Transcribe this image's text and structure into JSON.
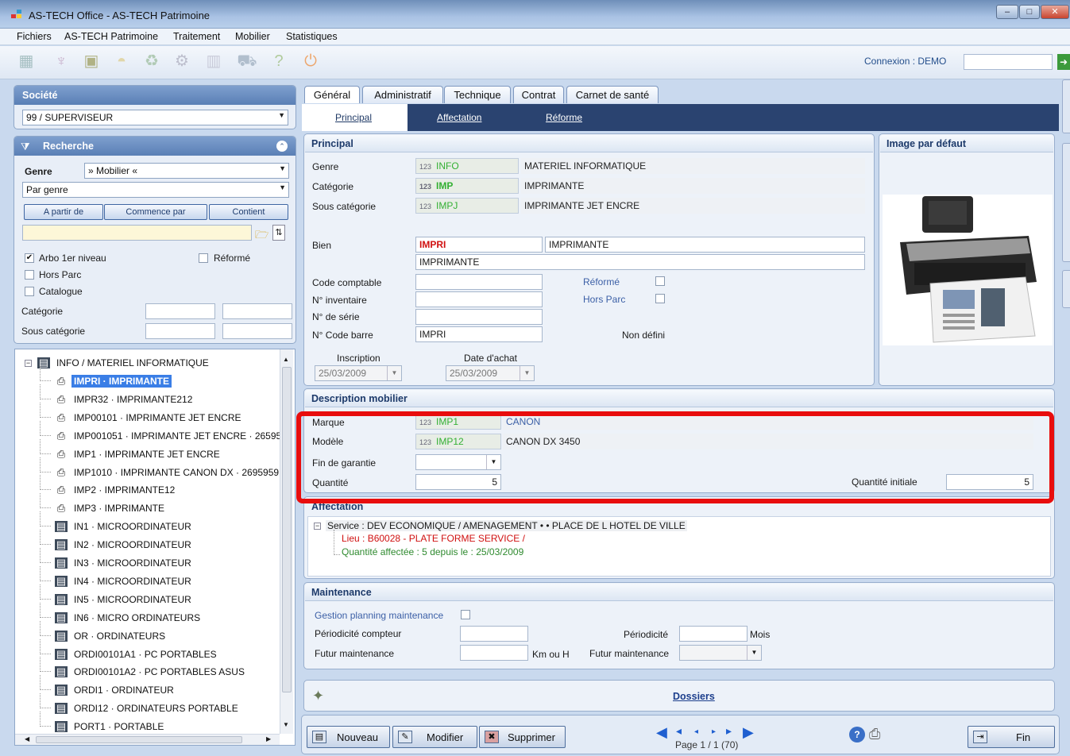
{
  "window": {
    "title": "AS-TECH Office - AS-TECH Patrimoine",
    "minimize": "–",
    "maximize": "□",
    "close": "✕"
  },
  "menu": [
    "Fichiers",
    "AS-TECH Patrimoine",
    "Traitement",
    "Mobilier",
    "Statistiques"
  ],
  "toolbar": {
    "icons": [
      "building-icon",
      "pin-icon",
      "chest-icon",
      "hardhat-icon",
      "recycle-icon",
      "gears-icon",
      "books-icon",
      "truck-icon",
      "help-icon",
      "power-icon"
    ],
    "connexion": "Connexion : DEMO"
  },
  "sidebar": {
    "societe_title": "Société",
    "societe_value": "99 / SUPERVISEUR",
    "recherche_title": "Recherche",
    "genre_label": "Genre",
    "genre_value": "» Mobilier «",
    "par_genre": "Par genre",
    "buttons": [
      "A partir de",
      "Commence par",
      "Contient"
    ],
    "arbo_label": "Arbo 1er niveau",
    "reforme_label": "Réformé",
    "hors_parc_label": "Hors Parc",
    "catalogue_label": "Catalogue",
    "categorie_label": "Catégorie",
    "sous_categorie_label": "Sous catégorie"
  },
  "tree": {
    "root": "INFO / MATERIEL INFORMATIQUE",
    "items": [
      {
        "label": "IMPRI · IMPRIMANTE",
        "icon": "printer-icon"
      },
      {
        "label": "IMPR32 · IMPRIMANTE212",
        "icon": "printer-icon"
      },
      {
        "label": "IMP00101 · IMPRIMANTE JET ENCRE",
        "icon": "printer-icon"
      },
      {
        "label": "IMP001051 · IMPRIMANTE JET ENCRE · 26595",
        "icon": "printer-icon"
      },
      {
        "label": "IMP1 · IMPRIMANTE JET ENCRE",
        "icon": "printer-icon"
      },
      {
        "label": "IMP1010 · IMPRIMANTE CANON DX · 2695959",
        "icon": "printer-icon"
      },
      {
        "label": "IMP2 · IMPRIMANTE12",
        "icon": "printer-icon"
      },
      {
        "label": "IMP3 · IMPRIMANTE",
        "icon": "printer-icon"
      },
      {
        "label": "IN1 · MICROORDINATEUR",
        "icon": "computer-icon"
      },
      {
        "label": "IN2 · MICROORDINATEUR",
        "icon": "computer-icon"
      },
      {
        "label": "IN3 · MICROORDINATEUR",
        "icon": "computer-icon"
      },
      {
        "label": "IN4 · MICROORDINATEUR",
        "icon": "computer-icon"
      },
      {
        "label": "IN5 · MICROORDINATEUR",
        "icon": "computer-icon"
      },
      {
        "label": "IN6 · MICRO ORDINATEURS",
        "icon": "computer-icon"
      },
      {
        "label": "OR · ORDINATEURS",
        "icon": "computer-icon"
      },
      {
        "label": "ORDI00101A1 · PC PORTABLES",
        "icon": "computer-icon"
      },
      {
        "label": "ORDI00101A2 · PC PORTABLES ASUS",
        "icon": "computer-icon"
      },
      {
        "label": "ORDI1 · ORDINATEUR",
        "icon": "computer-icon"
      },
      {
        "label": "ORDI12 · ORDINATEURS PORTABLE",
        "icon": "computer-icon"
      },
      {
        "label": "PORT1 · PORTABLE",
        "icon": "computer-icon"
      }
    ]
  },
  "tabs": [
    "Général",
    "Administratif",
    "Technique",
    "Contrat",
    "Carnet de santé"
  ],
  "subtabs": [
    "Principal",
    "Affectation",
    "Réforme"
  ],
  "principal": {
    "title": "Principal",
    "genre_label": "Genre",
    "genre_code": "INFO",
    "genre_desc": "MATERIEL INFORMATIQUE",
    "categorie_label": "Catégorie",
    "categorie_code": "IMP",
    "categorie_desc": "IMPRIMANTE",
    "souscat_label": "Sous catégorie",
    "souscat_code": "IMPJ",
    "souscat_desc": "IMPRIMANTE JET ENCRE",
    "code_prefix": "123",
    "bien_label": "Bien",
    "bien_code": "IMPRI",
    "bien_name": "IMPRIMANTE",
    "bien_desc": "IMPRIMANTE",
    "code_comptable_label": "Code comptable",
    "reforme_label": "Réformé",
    "inventaire_label": "N° inventaire",
    "hors_parc_label": "Hors Parc",
    "serie_label": "N° de série",
    "code_barre_label": "N° Code barre",
    "code_barre_value": "IMPRI",
    "non_defini": "Non défini",
    "inscription_label": "Inscription",
    "inscription_value": "25/03/2009",
    "date_achat_label": "Date d'achat",
    "date_achat_value": "25/03/2009"
  },
  "image": {
    "title": "Image par défaut"
  },
  "description": {
    "title": "Description mobilier",
    "marque_label": "Marque",
    "marque_code": "IMP1",
    "marque_desc": "CANON",
    "modele_label": "Modèle",
    "modele_code": "IMP12",
    "modele_desc": "CANON DX 3450",
    "garantie_label": "Fin de garantie",
    "quantite_label": "Quantité",
    "quantite_value": "5",
    "qte_initiale_label": "Quantité initiale",
    "qte_initiale_value": "5"
  },
  "affectation": {
    "title": "Affectation",
    "service": "Service : DEV ECONOMIQUE / AMENAGEMENT • • PLACE DE L HOTEL DE VILLE",
    "lieu": "Lieu : B60028 - PLATE FORME SERVICE /",
    "quantite": "Quantité affectée : 5  depuis le : 25/03/2009"
  },
  "maintenance": {
    "title": "Maintenance",
    "gestion_label": "Gestion planning maintenance",
    "periodicite_compteur_label": "Périodicité compteur",
    "periodicite_label": "Périodicité",
    "mois": "Mois",
    "futur_label": "Futur maintenance",
    "km_ou_h": "Km ou H",
    "futur2_label": "Futur maintenance"
  },
  "dossiers": "Dossiers",
  "bottom": {
    "nouveau": "Nouveau",
    "modifier": "Modifier",
    "supprimer": "Supprimer",
    "page": "Page 1 / 1 (70)",
    "fin": "Fin"
  },
  "colors": {
    "accent": "#2a4370",
    "highlight": "#e80d0d",
    "selection": "#3a7ee6"
  }
}
